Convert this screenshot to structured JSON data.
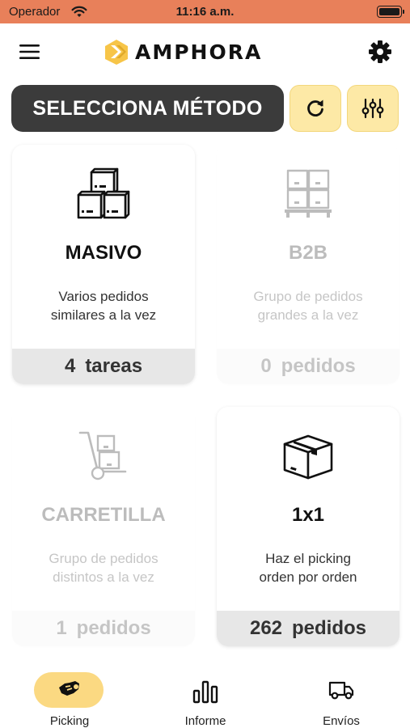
{
  "status_bar": {
    "carrier": "Operador",
    "time": "11:16 a.m."
  },
  "header": {
    "logo_text": "AMPHORA",
    "menu_icon": "hamburger-menu-icon",
    "settings_icon": "gear-icon"
  },
  "toolbar": {
    "method_label": "SELECCIONA MÉTODO",
    "refresh_icon": "refresh-icon",
    "filter_icon": "sliders-icon"
  },
  "cards": [
    {
      "title": "MASIVO",
      "desc_line1": "Varios pedidos",
      "desc_line2": "similares a la vez",
      "count": "4",
      "unit": "tareas",
      "enabled": true,
      "icon": "stacked-boxes-icon"
    },
    {
      "title": "B2B",
      "desc_line1": "Grupo de pedidos",
      "desc_line2": "grandes a la vez",
      "count": "0",
      "unit": "pedidos",
      "enabled": false,
      "icon": "pallet-boxes-icon"
    },
    {
      "title": "CARRETILLA",
      "desc_line1": "Grupo de pedidos",
      "desc_line2": "distintos a la vez",
      "count": "1",
      "unit": "pedidos",
      "enabled": false,
      "icon": "hand-truck-icon"
    },
    {
      "title": "1x1",
      "desc_line1": "Haz el picking",
      "desc_line2": "orden por orden",
      "count": "262",
      "unit": "pedidos",
      "enabled": true,
      "icon": "single-box-icon"
    }
  ],
  "tabs": [
    {
      "label": "Picking",
      "active": true,
      "icon": "picking-hand-icon"
    },
    {
      "label": "Informe",
      "active": false,
      "icon": "bar-chart-icon"
    },
    {
      "label": "Envíos",
      "active": false,
      "icon": "delivery-truck-icon"
    }
  ],
  "colors": {
    "status_bar": "#e8805a",
    "accent": "#fde9a6",
    "active_tab": "#fbd982",
    "method_label_bg": "#3b3b3b"
  }
}
